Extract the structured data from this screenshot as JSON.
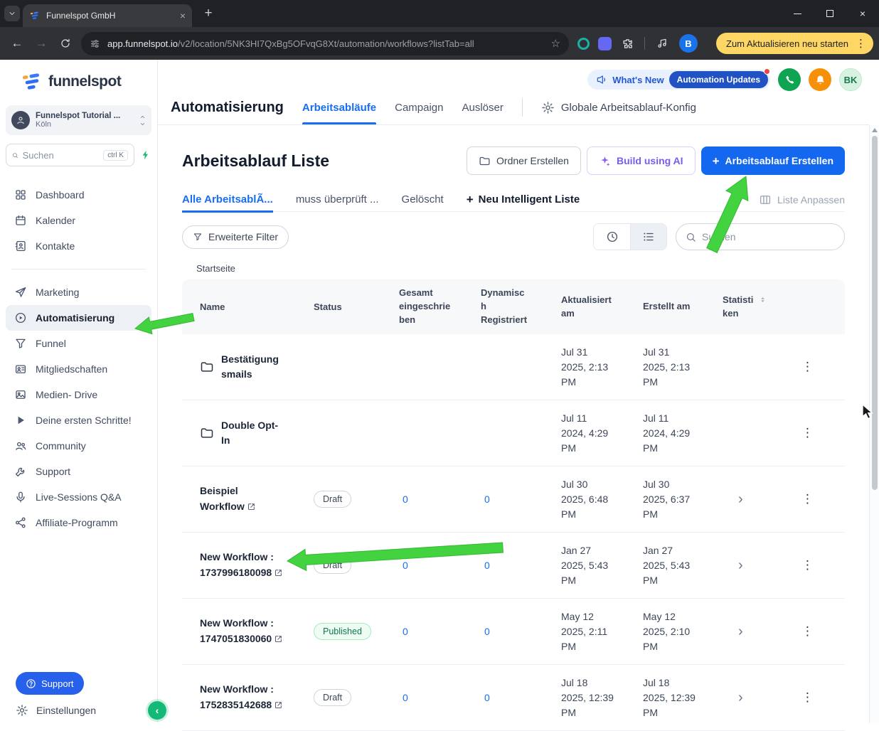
{
  "icons": {
    "close": "×",
    "plus": "+",
    "back": "←",
    "forward": "→",
    "star": "☆",
    "kebab": "⋮",
    "chevron_right": "›",
    "chevron_left": "‹"
  },
  "browser": {
    "tab_title": "Funnelspot GmbH",
    "url_domain": "app.funnelspot.io",
    "url_path": "/v2/location/5NK3HI7QxBg5OFvqG8Xt/automation/workflows?listTab=all",
    "restart_pill": "Zum Aktualisieren neu starten",
    "profile_initial": "B"
  },
  "sidebar": {
    "logo_text": "funnelspot",
    "location_name": "Funnelspot Tutorial ...",
    "location_city": "Köln",
    "search_placeholder": "Suchen",
    "search_shortcut": "ctrl K",
    "items": [
      {
        "label": "Dashboard"
      },
      {
        "label": "Kalender"
      },
      {
        "label": "Kontakte"
      },
      {
        "label": "Marketing"
      },
      {
        "label": "Automatisierung"
      },
      {
        "label": "Funnel"
      },
      {
        "label": "Mitgliedschaften"
      },
      {
        "label": "Medien- Drive"
      },
      {
        "label": "Deine ersten Schritte!"
      },
      {
        "label": "Community"
      },
      {
        "label": "Support"
      },
      {
        "label": "Live-Sessions Q&A"
      },
      {
        "label": "Affiliate-Programm"
      }
    ],
    "support_button": "Support",
    "settings_label": "Einstellungen"
  },
  "header": {
    "title": "Automatisierung",
    "tabs": [
      {
        "label": "Arbeitsabläufe"
      },
      {
        "label": "Campaign"
      },
      {
        "label": "Auslöser"
      }
    ],
    "config_label": "Globale Arbeitsablauf-Konfig",
    "whats_new": "What's New",
    "updates_pill": "Automation Updates",
    "avatar_initials": "BK"
  },
  "page": {
    "title": "Arbeitsablauf Liste",
    "folder_button": "Ordner Erstellen",
    "ai_button": "Build using AI",
    "create_button": "Arbeitsablauf Erstellen",
    "tabs": [
      {
        "label": "Alle ArbeitsablÃ..."
      },
      {
        "label": "muss überprüft ..."
      },
      {
        "label": "Gelöscht"
      },
      {
        "label": "Neu Intelligent Liste"
      }
    ],
    "customize_list": "Liste Anpassen",
    "filter_button": "Erweiterte Filter",
    "search_placeholder": "Suchen",
    "breadcrumb": "Startseite"
  },
  "table": {
    "headers": {
      "name": "Name",
      "status": "Status",
      "enrolled": "Gesamt eingeschrieben",
      "dynamic": "Dynamisch Registriert",
      "updated": "Aktualisiert am",
      "created": "Erstellt am",
      "stats": "Statistiken"
    },
    "rows": [
      {
        "type": "folder",
        "name": "Bestätigung smails",
        "updated": "Jul 31 2025, 2:13 PM",
        "created": "Jul 31 2025, 2:13 PM"
      },
      {
        "type": "folder",
        "name": "Double Opt-In",
        "updated": "Jul 11 2024, 4:29 PM",
        "created": "Jul 11 2024, 4:29 PM"
      },
      {
        "type": "workflow",
        "name": "Beispiel Workflow",
        "status": "Draft",
        "enrolled": "0",
        "dynamic": "0",
        "updated": "Jul 30 2025, 6:48 PM",
        "created": "Jul 30 2025, 6:37 PM"
      },
      {
        "type": "workflow",
        "name": "New Workflow : 1737996180098",
        "status": "Draft",
        "enrolled": "0",
        "dynamic": "0",
        "updated": "Jan 27 2025, 5:43 PM",
        "created": "Jan 27 2025, 5:43 PM"
      },
      {
        "type": "workflow",
        "name": "New Workflow : 1747051830060",
        "status": "Published",
        "enrolled": "0",
        "dynamic": "0",
        "updated": "May 12 2025, 2:11 PM",
        "created": "May 12 2025, 2:10 PM"
      },
      {
        "type": "workflow",
        "name": "New Workflow : 1752835142688",
        "status": "Draft",
        "enrolled": "0",
        "dynamic": "0",
        "updated": "Jul 18 2025, 12:39 PM",
        "created": "Jul 18 2025, 12:39 PM"
      }
    ]
  },
  "colors": {
    "accent_blue": "#1467ef",
    "annotation_green": "#43d240",
    "published_green": "#0a7a4b",
    "update_pill_yellow": "#fdd663"
  }
}
